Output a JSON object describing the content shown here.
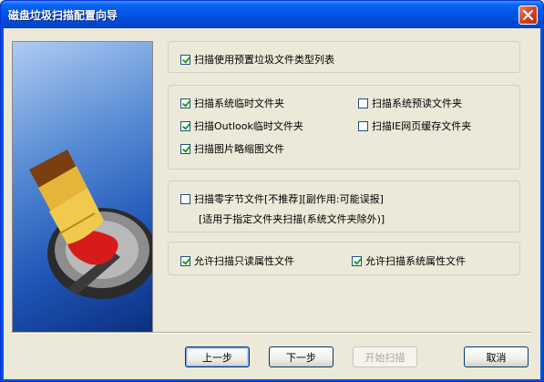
{
  "window": {
    "title": "磁盘垃圾扫描配置向导"
  },
  "options": {
    "preset_list": {
      "label": "扫描使用预置垃圾文件类型列表",
      "checked": true
    },
    "system_temp": {
      "label": "扫描系统临时文件夹",
      "checked": true
    },
    "system_prefetch": {
      "label": "扫描系统预读文件夹",
      "checked": false
    },
    "outlook_temp": {
      "label": "扫描Outlook临时文件夹",
      "checked": true
    },
    "ie_cache": {
      "label": "扫描IE网页缓存文件夹",
      "checked": false
    },
    "thumbnails": {
      "label": "扫描图片略缩图文件",
      "checked": true
    },
    "zero_byte": {
      "label": "扫描零字节文件[不推荐][副作用:可能误报]",
      "checked": false
    },
    "zero_byte_note": "[适用于指定文件夹扫描(系统文件夹除外)]",
    "readonly_attr": {
      "label": "允许扫描只读属性文件",
      "checked": true
    },
    "system_attr": {
      "label": "允许扫描系统属性文件",
      "checked": true
    }
  },
  "buttons": {
    "prev": "上一步",
    "next": "下一步",
    "start": "开始扫描",
    "cancel": "取消"
  },
  "icons": {
    "side_image": "disk-broom-illustration",
    "close": "close-icon"
  }
}
